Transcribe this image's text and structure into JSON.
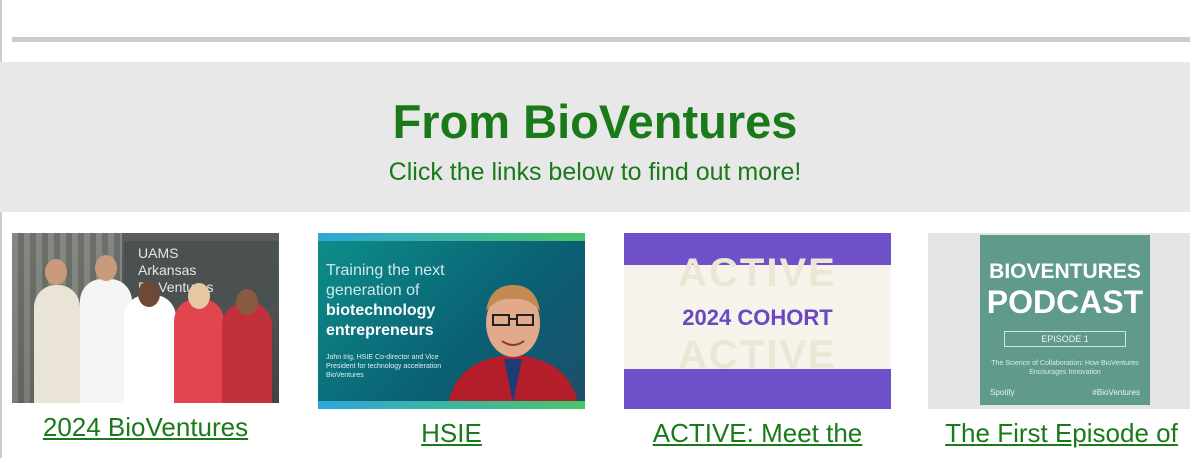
{
  "header": {
    "title": "From BioVentures",
    "subtitle": "Click the links below to find out more!"
  },
  "colors": {
    "accent_green": "#1a7a1a",
    "band_gray": "#e8e8e8",
    "rule_gray": "#cccccc"
  },
  "cards": [
    {
      "caption": "2024 BioVentures",
      "image_sign": "UAMS\nArkansas\nBioVentures",
      "icon": "team-photo"
    },
    {
      "caption": "HSIE",
      "image_title_1": "Training the next\ngeneration of",
      "image_title_2": "biotechnology\nentrepreneurs",
      "image_note": "John Irig, HSIE Co-director and Vice President for technology acceleration BioVentures",
      "icon": "portrait-photo"
    },
    {
      "caption": "ACTIVE: Meet the",
      "image_ghost": "ACTIVE",
      "image_label": "2024 COHORT",
      "icon": "cohort-banner"
    },
    {
      "caption": "The First Episode of",
      "image_title_1": "BIOVENTURES",
      "image_title_2": "PODCAST",
      "image_episode": "EPISODE 1",
      "image_desc": "The Science of Collaboration: How BioVentures Encourages Innovation",
      "image_brand": "Spotify",
      "image_tag": "#BioVentures",
      "icon": "podcast-cover"
    }
  ]
}
